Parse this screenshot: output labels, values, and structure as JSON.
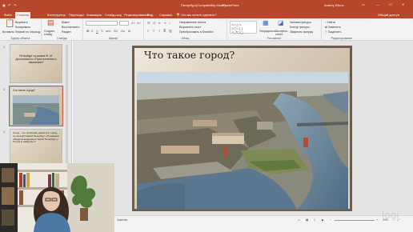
{
  "window": {
    "file_name": "Петербург(Compatibility Mode)",
    "app_name": "PowerPoint",
    "search_hint": "Что вы хотите сделать?",
    "user": "Andrey Elisov",
    "share": "Общий доступ"
  },
  "tabs": [
    "Файл",
    "Главная",
    "Конструктор",
    "Переходы",
    "Анимация",
    "Слайд-шоу",
    "Рецензирование",
    "Вид",
    "Справка"
  ],
  "active_tab": "Главная",
  "ribbon": {
    "clipboard": {
      "label": "Буфер обмена",
      "paste": "Вставить",
      "cut": "Вырезать",
      "copy": "Копировать",
      "format_painter": "Формат по образцу"
    },
    "slides": {
      "label": "Слайды",
      "new_slide": "Создать слайд",
      "layout": "Макет",
      "reset": "Восстановить",
      "section": "Раздел"
    },
    "font": {
      "label": "Шрифт"
    },
    "paragraph": {
      "label": "Абзац",
      "text_direction": "Направление текста",
      "align_text": "Выровнять текст",
      "smartart": "Преобразовать в SmartArt"
    },
    "drawing": {
      "label": "Рисование",
      "arrange": "Упорядочить",
      "quick_styles": "Экспресс-стили",
      "shape_fill": "Заливка фигуры",
      "shape_outline": "Контур фигуры",
      "shape_effects": "Эффекты фигуры"
    },
    "editing": {
      "label": "Редактирование",
      "find": "Найти",
      "replace": "Заменить",
      "select": "Выделить"
    }
  },
  "thumbnails": [
    {
      "num": "1",
      "text": "Петербург в романе Ф. М. Достоевского «Преступление и наказание»"
    },
    {
      "num": "2",
      "text": "Что такое город?"
    },
    {
      "num": "3",
      "text": "Город – это проблема: какой этот город, по-твоему? Какой Петербург у Пушкина в «Медном всаднике»? Какой Петербург у Гоголя в «Шинели»?"
    }
  ],
  "slide": {
    "title": "Что такое город?"
  },
  "status": {
    "notes": "Заметки",
    "zoom": "94%"
  },
  "watermark": "logi"
}
